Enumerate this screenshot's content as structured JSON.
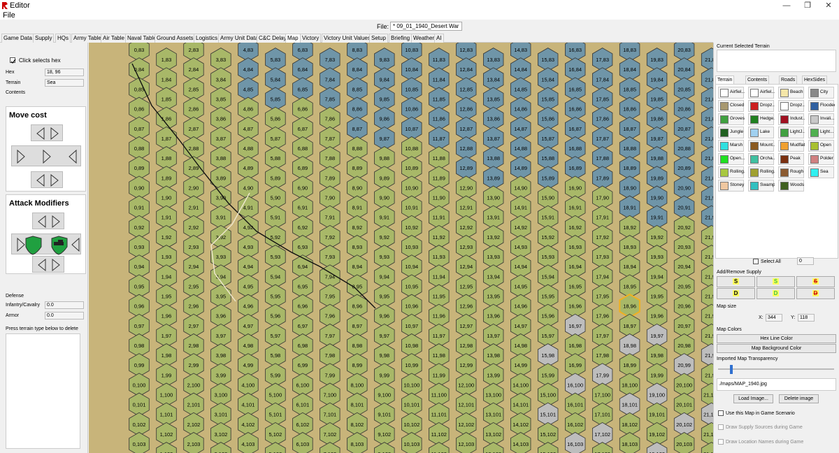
{
  "window": {
    "title": "Editor",
    "min_glyph": "—",
    "max_glyph": "❐",
    "close_glyph": "✕"
  },
  "menu": {
    "file": "File"
  },
  "file_bar": {
    "label": "File:",
    "value": "* 09_01_1940_Desert War"
  },
  "tabs": [
    "Game Data",
    "Supply",
    "HQs",
    "Army Table",
    "Air Table",
    "Naval Table",
    "Ground Assets",
    "Logistics",
    "Army Unit Data",
    "C&C Delay",
    "Map",
    "Victory",
    "Victory Unit Values",
    "Setup",
    "Briefing",
    "Weather",
    "AI"
  ],
  "active_tab": "Map",
  "left": {
    "click_selects_hex": "Click selects hex",
    "hex_label": "Hex",
    "hex_value": "18, 96",
    "terrain_label": "Terrain",
    "terrain_value": "Sea",
    "contents_label": "Contents",
    "move_cost_title": "Move cost",
    "attack_modifiers_title": "Attack Modifiers",
    "defense_label": "Defense",
    "infantry_label": "Infantry/Cavalry",
    "infantry_value": "0.0",
    "armor_label": "Armor",
    "armor_value": "0.0",
    "delete_hint": "Press terrain type below to delete"
  },
  "map": {
    "cols": 44,
    "rows": 22,
    "first_col": 0,
    "first_row": 83,
    "selected_hex": "18,96",
    "colors": {
      "land": "#a8b868",
      "sea": "#6f95a8",
      "sand": "#c8b47a",
      "rough": "#bdbdbd",
      "hexline": "#333333",
      "selected": "#f0b020"
    }
  },
  "right": {
    "current_terrain_title": "Current Selected Terrain",
    "tabs": [
      "Terrain",
      "Contents",
      "Roads",
      "HexSides"
    ],
    "terrain": [
      {
        "label": "Airfiel...",
        "color": "#ffffff",
        "icon": "airfield-black-icon"
      },
      {
        "label": "Airfiel...",
        "color": "#ffffff",
        "icon": "airfield-red-icon"
      },
      {
        "label": "Beach",
        "color": "#f5e6a8",
        "icon": "beach-icon"
      },
      {
        "label": "City",
        "color": "#888888",
        "icon": "city-icon"
      },
      {
        "label": "Closed",
        "color": "#a89870",
        "icon": "closed-icon"
      },
      {
        "label": "Dropz...",
        "color": "#cc2020",
        "icon": "dropzone-red-icon"
      },
      {
        "label": "Dropz...",
        "color": "#ffffff",
        "icon": "dropzone-icon"
      },
      {
        "label": "Flooded",
        "color": "#3060a0",
        "icon": "flooded-icon"
      },
      {
        "label": "Groves",
        "color": "#40a040",
        "icon": "groves-icon"
      },
      {
        "label": "Hedge...",
        "color": "#208020",
        "icon": "hedgerow-icon"
      },
      {
        "label": "Indust...",
        "color": "#a01020",
        "icon": "industrial-icon"
      },
      {
        "label": "Invali...",
        "color": "#c8c8c8",
        "icon": "invalid-icon"
      },
      {
        "label": "Jungle",
        "color": "#206020",
        "icon": "jungle-icon"
      },
      {
        "label": "Lake",
        "color": "#a0d0f0",
        "icon": "lake-icon"
      },
      {
        "label": "LightJ...",
        "color": "#40a040",
        "icon": "light-jungle-icon"
      },
      {
        "label": "Light...",
        "color": "#50b050",
        "icon": "light-woods-icon"
      },
      {
        "label": "Marsh",
        "color": "#30e0e0",
        "icon": "marsh-icon"
      },
      {
        "label": "Mount...",
        "color": "#8b5a20",
        "icon": "mountain-icon"
      },
      {
        "label": "Mudflats",
        "color": "#f0a030",
        "icon": "mudflats-icon"
      },
      {
        "label": "Open",
        "color": "#a8c030",
        "icon": "open-icon"
      },
      {
        "label": "Open...",
        "color": "#20e020",
        "icon": "open-green-icon"
      },
      {
        "label": "Orcha...",
        "color": "#40c0a0",
        "icon": "orchard-icon"
      },
      {
        "label": "Peak",
        "color": "#7a3010",
        "icon": "peak-icon"
      },
      {
        "label": "Polder",
        "color": "#d08080",
        "icon": "polder-icon"
      },
      {
        "label": "Rolling...",
        "color": "#a8c840",
        "icon": "rolling-icon"
      },
      {
        "label": "Rolling...",
        "color": "#a0a030",
        "icon": "rolling-2-icon"
      },
      {
        "label": "Rough",
        "color": "#8b5a30",
        "icon": "rough-icon"
      },
      {
        "label": "Sea",
        "color": "#30f0f0",
        "icon": "sea-icon"
      },
      {
        "label": "Stoney",
        "color": "#f0c8a0",
        "icon": "stoney-icon"
      },
      {
        "label": "Swamp",
        "color": "#30c0c0",
        "icon": "swamp-icon"
      },
      {
        "label": "Woods",
        "color": "#406020",
        "icon": "woods-icon"
      }
    ],
    "select_all": "Select All",
    "select_all_value": "0",
    "supply_title": "Add/Remove Supply",
    "supply_letters": [
      "S",
      "S",
      "S",
      "D",
      "D",
      "D"
    ],
    "map_size_title": "Map size",
    "x_label": "X:",
    "x_value": "344",
    "y_label": "Y:",
    "y_value": "118",
    "map_colors_title": "Map Colors",
    "hex_line_color": "Hex Line Color",
    "map_background_color": "Map Background Color",
    "transparency_title": "Imported Map Transparency",
    "transparency_level": 0.1,
    "image_path": "./maps/MAP_1940.jpg",
    "load_image": "Load Image...",
    "delete_image": "Delete image",
    "use_map": "Use this Map in Game Scenario",
    "draw_supply": "Draw Supply Sources during Game",
    "draw_location": "Draw Location Names during Game"
  }
}
